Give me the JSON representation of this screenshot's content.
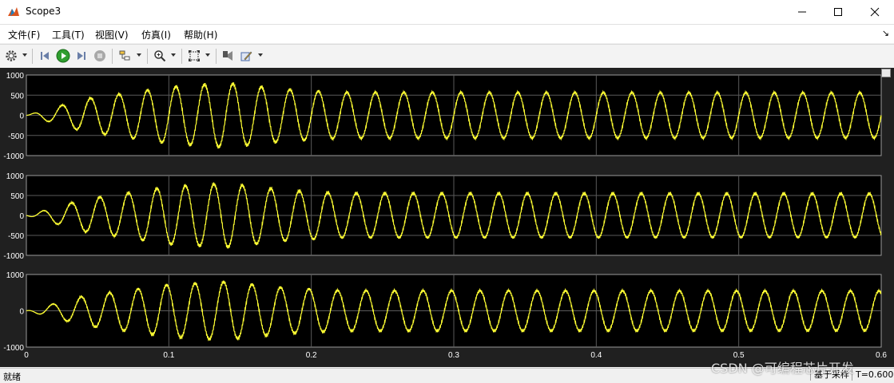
{
  "window": {
    "title": "Scope3",
    "icon": "matlab-scope-icon",
    "controls": [
      "minimize-icon",
      "maximize-icon",
      "close-icon"
    ]
  },
  "menu": {
    "items": [
      {
        "label": "文件(F)"
      },
      {
        "label": "工具(T)"
      },
      {
        "label": "视图(V)"
      },
      {
        "label": "仿真(I)"
      },
      {
        "label": "帮助(H)"
      }
    ],
    "dock_glyph": "↘"
  },
  "toolbar": {
    "buttons": [
      {
        "name": "settings-icon",
        "has_dropdown": true
      },
      {
        "name": "step-back-icon",
        "has_dropdown": false
      },
      {
        "name": "run-icon",
        "has_dropdown": false
      },
      {
        "name": "step-forward-icon",
        "has_dropdown": false
      },
      {
        "name": "stop-icon",
        "has_dropdown": false
      },
      {
        "name": "highlight-block-icon",
        "has_dropdown": true
      },
      {
        "name": "zoom-icon",
        "has_dropdown": true
      },
      {
        "name": "autoscale-icon",
        "has_dropdown": true
      },
      {
        "name": "cursor-measure-icon",
        "has_dropdown": false
      },
      {
        "name": "style-edit-icon",
        "has_dropdown": true
      }
    ]
  },
  "colors": {
    "trace": "#ffff33",
    "axes_bg": "#000000",
    "figure_bg": "#202020",
    "grid": "#5a5a5a",
    "tick_text": "#ffffff",
    "titlebar_bg": "#ffffff"
  },
  "chart_data": [
    {
      "type": "line",
      "name": "axes-1",
      "xlim": [
        0,
        0.6
      ],
      "ylim": [
        -1000,
        1000
      ],
      "yticks": [
        "1000",
        "500",
        "0",
        "-500",
        "-1000"
      ],
      "grid": true,
      "description_of_signal": "sinusoid ~50 Hz, grows from 0 to ~800 peak near t=0.15 then settles to ~550",
      "frequency_hz": 50,
      "phase_cycles": 0,
      "envelope": [
        [
          0,
          0
        ],
        [
          0.04,
          400
        ],
        [
          0.1,
          700
        ],
        [
          0.14,
          800
        ],
        [
          0.18,
          650
        ],
        [
          0.22,
          570
        ],
        [
          0.6,
          560
        ]
      ]
    },
    {
      "type": "line",
      "name": "axes-2",
      "xlim": [
        0,
        0.6
      ],
      "ylim": [
        -1000,
        1000
      ],
      "yticks": [
        "1000",
        "500",
        "0",
        "-500",
        "-1000"
      ],
      "grid": true,
      "frequency_hz": 50,
      "phase_cycles": 0.33,
      "envelope": [
        [
          0,
          0
        ],
        [
          0.04,
          400
        ],
        [
          0.1,
          720
        ],
        [
          0.14,
          800
        ],
        [
          0.18,
          640
        ],
        [
          0.22,
          560
        ],
        [
          0.6,
          550
        ]
      ]
    },
    {
      "type": "line",
      "name": "axes-3",
      "xlim": [
        0,
        0.6
      ],
      "ylim": [
        -1000,
        1000
      ],
      "yticks": [
        "1000",
        "0",
        "-1000"
      ],
      "xticks": [
        "0",
        "0.1",
        "0.2",
        "0.3",
        "0.4",
        "0.5",
        "0.6"
      ],
      "grid": true,
      "frequency_hz": 50,
      "phase_cycles": 0.67,
      "envelope": [
        [
          0,
          0
        ],
        [
          0.04,
          400
        ],
        [
          0.1,
          720
        ],
        [
          0.14,
          800
        ],
        [
          0.18,
          640
        ],
        [
          0.22,
          560
        ],
        [
          0.6,
          550
        ]
      ]
    }
  ],
  "status": {
    "left": "就绪",
    "mode": "基于采样",
    "time": "T=0.600"
  },
  "watermark": "CSDN @可编程芯片开发"
}
